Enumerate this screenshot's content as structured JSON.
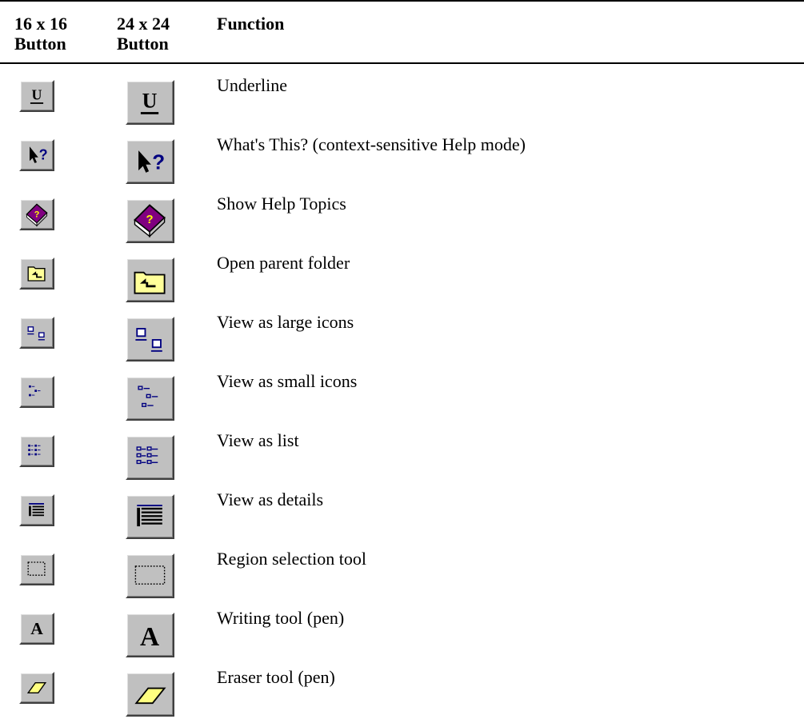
{
  "table": {
    "headers": {
      "col16_line1": "16 x 16",
      "col16_line2": "Button",
      "col24_line1": "24 x 24",
      "col24_line2": "Button",
      "function": "Function"
    },
    "rows": [
      {
        "icon": "underline-icon",
        "function": "Underline"
      },
      {
        "icon": "whats-this-icon",
        "function": "What's This? (context-sensitive Help mode)"
      },
      {
        "icon": "help-book-icon",
        "function": "Show Help Topics"
      },
      {
        "icon": "parent-folder-icon",
        "function": "Open parent folder"
      },
      {
        "icon": "large-icons-view-icon",
        "function": "View as large icons"
      },
      {
        "icon": "small-icons-view-icon",
        "function": "View as small icons"
      },
      {
        "icon": "list-view-icon",
        "function": "View as list"
      },
      {
        "icon": "details-view-icon",
        "function": "View as details"
      },
      {
        "icon": "region-select-icon",
        "function": "Region selection tool"
      },
      {
        "icon": "writing-tool-icon",
        "function": "Writing tool (pen)"
      },
      {
        "icon": "eraser-icon",
        "function": "Eraser tool (pen)"
      }
    ]
  },
  "icon_glyphs": {
    "underline": "U",
    "writing": "A",
    "whats_this": "?",
    "help_book": "?"
  },
  "colors": {
    "button_face": "#c0c0c0",
    "folder_yellow": "#ffff99",
    "icon_blue": "#000080",
    "book_purple": "#800080",
    "eraser_yellow": "#ffff80"
  }
}
